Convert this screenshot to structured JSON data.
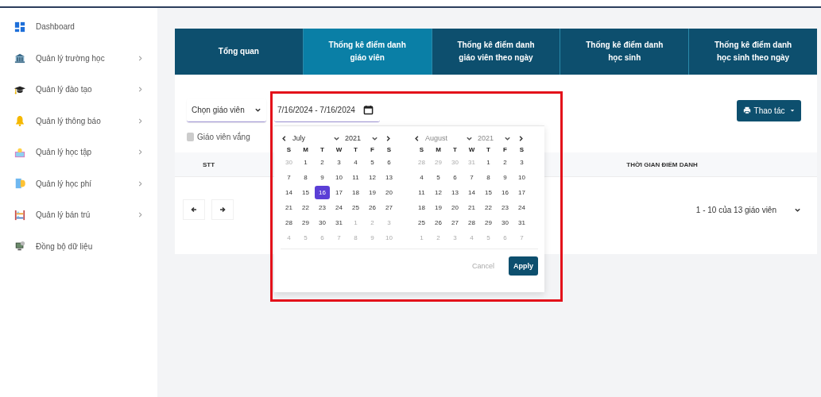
{
  "sidebar": {
    "items": [
      {
        "kind": "dashboard",
        "label": "Dashboard",
        "has_children": false
      },
      {
        "kind": "school",
        "label": "Quản lý trường học",
        "has_children": true
      },
      {
        "kind": "training",
        "label": "Quản lý đào tạo",
        "has_children": true
      },
      {
        "kind": "notice",
        "label": "Quản lý thông báo",
        "has_children": true
      },
      {
        "kind": "study",
        "label": "Quản lý học tập",
        "has_children": true
      },
      {
        "kind": "fee",
        "label": "Quản lý học phí",
        "has_children": true
      },
      {
        "kind": "boarding",
        "label": "Quản lý bán trú",
        "has_children": true
      },
      {
        "kind": "sync",
        "label": "Đồng bộ dữ liệu",
        "has_children": false
      }
    ]
  },
  "tabs": [
    {
      "label": "Tổng quan",
      "selected": false
    },
    {
      "label": "Thống kê điểm danh giáo viên",
      "selected": true
    },
    {
      "label": "Thống kê điểm danh giáo viên theo ngày",
      "selected": false
    },
    {
      "label": "Thống kê điểm danh học sinh",
      "selected": false
    },
    {
      "label": "Thống kê điểm danh học sinh theo ngày",
      "selected": false
    }
  ],
  "filters": {
    "teacher_select": "Chọn giáo viên",
    "date_range": "7/16/2024 - 7/16/2024",
    "absent_checkbox": {
      "label": "Giáo viên vắng",
      "checked": false
    }
  },
  "actions_button": "Thao tác",
  "table": {
    "columns": [
      "STT",
      "THỜI GIAN ĐIỂM DANH"
    ]
  },
  "pagination": {
    "summary": "1 - 10 của 13 giáo viên"
  },
  "date_picker": {
    "months": [
      {
        "month": "July",
        "year": "2021",
        "weekdays": [
          "S",
          "M",
          "T",
          "W",
          "T",
          "F",
          "S"
        ],
        "weeks": [
          [
            {
              "text": "30",
              "outside": true,
              "selected": false
            },
            {
              "text": "1",
              "outside": false,
              "selected": false
            },
            {
              "text": "2",
              "outside": false,
              "selected": false
            },
            {
              "text": "3",
              "outside": false,
              "selected": false
            },
            {
              "text": "4",
              "outside": false,
              "selected": false
            },
            {
              "text": "5",
              "outside": false,
              "selected": false
            },
            {
              "text": "6",
              "outside": false,
              "selected": false
            }
          ],
          [
            {
              "text": "7",
              "outside": false,
              "selected": false
            },
            {
              "text": "8",
              "outside": false,
              "selected": false
            },
            {
              "text": "9",
              "outside": false,
              "selected": false
            },
            {
              "text": "10",
              "outside": false,
              "selected": false
            },
            {
              "text": "11",
              "outside": false,
              "selected": false
            },
            {
              "text": "12",
              "outside": false,
              "selected": false
            },
            {
              "text": "13",
              "outside": false,
              "selected": false
            }
          ],
          [
            {
              "text": "14",
              "outside": false,
              "selected": false
            },
            {
              "text": "15",
              "outside": false,
              "selected": false
            },
            {
              "text": "16",
              "outside": false,
              "selected": true
            },
            {
              "text": "17",
              "outside": false,
              "selected": false
            },
            {
              "text": "18",
              "outside": false,
              "selected": false
            },
            {
              "text": "19",
              "outside": false,
              "selected": false
            },
            {
              "text": "20",
              "outside": false,
              "selected": false
            }
          ],
          [
            {
              "text": "21",
              "outside": false,
              "selected": false
            },
            {
              "text": "22",
              "outside": false,
              "selected": false
            },
            {
              "text": "23",
              "outside": false,
              "selected": false
            },
            {
              "text": "24",
              "outside": false,
              "selected": false
            },
            {
              "text": "25",
              "outside": false,
              "selected": false
            },
            {
              "text": "26",
              "outside": false,
              "selected": false
            },
            {
              "text": "27",
              "outside": false,
              "selected": false
            }
          ],
          [
            {
              "text": "28",
              "outside": false,
              "selected": false
            },
            {
              "text": "29",
              "outside": false,
              "selected": false
            },
            {
              "text": "30",
              "outside": false,
              "selected": false
            },
            {
              "text": "31",
              "outside": false,
              "selected": false
            },
            {
              "text": "1",
              "outside": true,
              "selected": false
            },
            {
              "text": "2",
              "outside": true,
              "selected": false
            },
            {
              "text": "3",
              "outside": true,
              "selected": false
            }
          ],
          [
            {
              "text": "4",
              "outside": true,
              "selected": false
            },
            {
              "text": "5",
              "outside": true,
              "selected": false
            },
            {
              "text": "6",
              "outside": true,
              "selected": false
            },
            {
              "text": "7",
              "outside": true,
              "selected": false
            },
            {
              "text": "8",
              "outside": true,
              "selected": false
            },
            {
              "text": "9",
              "outside": true,
              "selected": false
            },
            {
              "text": "10",
              "outside": true,
              "selected": false
            }
          ]
        ]
      },
      {
        "month": "August",
        "year": "2021",
        "weekdays": [
          "S",
          "M",
          "T",
          "W",
          "T",
          "F",
          "S"
        ],
        "weeks": [
          [
            {
              "text": "28",
              "outside": true,
              "selected": false
            },
            {
              "text": "29",
              "outside": true,
              "selected": false
            },
            {
              "text": "30",
              "outside": true,
              "selected": false
            },
            {
              "text": "31",
              "outside": true,
              "selected": false
            },
            {
              "text": "1",
              "outside": false,
              "selected": false
            },
            {
              "text": "2",
              "outside": false,
              "selected": false
            },
            {
              "text": "3",
              "outside": false,
              "selected": false
            }
          ],
          [
            {
              "text": "4",
              "outside": false,
              "selected": false
            },
            {
              "text": "5",
              "outside": false,
              "selected": false
            },
            {
              "text": "6",
              "outside": false,
              "selected": false
            },
            {
              "text": "7",
              "outside": false,
              "selected": false
            },
            {
              "text": "8",
              "outside": false,
              "selected": false
            },
            {
              "text": "9",
              "outside": false,
              "selected": false
            },
            {
              "text": "10",
              "outside": false,
              "selected": false
            }
          ],
          [
            {
              "text": "11",
              "outside": false,
              "selected": false
            },
            {
              "text": "12",
              "outside": false,
              "selected": false
            },
            {
              "text": "13",
              "outside": false,
              "selected": false
            },
            {
              "text": "14",
              "outside": false,
              "selected": false
            },
            {
              "text": "15",
              "outside": false,
              "selected": false
            },
            {
              "text": "16",
              "outside": false,
              "selected": false
            },
            {
              "text": "17",
              "outside": false,
              "selected": false
            }
          ],
          [
            {
              "text": "18",
              "outside": false,
              "selected": false
            },
            {
              "text": "19",
              "outside": false,
              "selected": false
            },
            {
              "text": "20",
              "outside": false,
              "selected": false
            },
            {
              "text": "21",
              "outside": false,
              "selected": false
            },
            {
              "text": "22",
              "outside": false,
              "selected": false
            },
            {
              "text": "23",
              "outside": false,
              "selected": false
            },
            {
              "text": "24",
              "outside": false,
              "selected": false
            }
          ],
          [
            {
              "text": "25",
              "outside": false,
              "selected": false
            },
            {
              "text": "26",
              "outside": false,
              "selected": false
            },
            {
              "text": "27",
              "outside": false,
              "selected": false
            },
            {
              "text": "28",
              "outside": false,
              "selected": false
            },
            {
              "text": "29",
              "outside": false,
              "selected": false
            },
            {
              "text": "30",
              "outside": false,
              "selected": false
            },
            {
              "text": "31",
              "outside": false,
              "selected": false
            }
          ],
          [
            {
              "text": "1",
              "outside": true,
              "selected": false
            },
            {
              "text": "2",
              "outside": true,
              "selected": false
            },
            {
              "text": "3",
              "outside": true,
              "selected": false
            },
            {
              "text": "4",
              "outside": true,
              "selected": false
            },
            {
              "text": "5",
              "outside": true,
              "selected": false
            },
            {
              "text": "6",
              "outside": true,
              "selected": false
            },
            {
              "text": "7",
              "outside": true,
              "selected": false
            }
          ]
        ]
      }
    ],
    "cancel": {
      "label": "Cancel",
      "disabled": true
    },
    "apply": {
      "label": "Apply",
      "disabled": false
    }
  }
}
